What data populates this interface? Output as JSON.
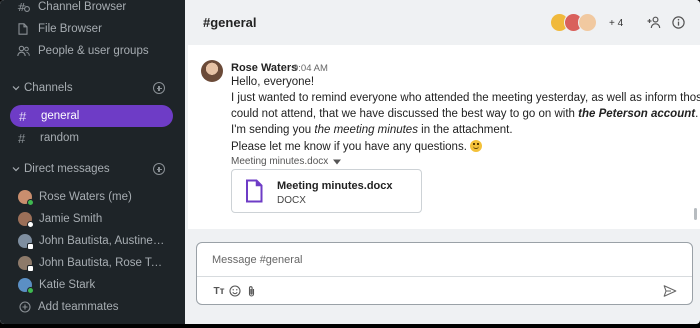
{
  "sidebar": {
    "top_items": [
      {
        "label": "Channel Browser",
        "icon": "channel-browser-icon"
      },
      {
        "label": "File Browser",
        "icon": "file-icon"
      },
      {
        "label": "People & user groups",
        "icon": "people-icon"
      }
    ],
    "channels_section": "Channels",
    "channels": [
      {
        "label": "general",
        "active": true
      },
      {
        "label": "random",
        "active": false
      }
    ],
    "dm_section": "Direct messages",
    "direct_messages": [
      {
        "label": "Rose Waters (me)",
        "status_color": "#3fb950",
        "avatar_color": "#c98e6e"
      },
      {
        "label": "Jamie Smith",
        "status_color": "#ffffff",
        "avatar_color": "#9b6f58"
      },
      {
        "label": "John Bautista, Austine W...",
        "status_color": "#ffffff",
        "avatar_color": "#7e8ea0"
      },
      {
        "label": "John Bautista, Rose Ten...",
        "status_color": "#ffffff",
        "avatar_color": "#8d7a6a"
      },
      {
        "label": "Katie Stark",
        "status_color": "#3fb950",
        "avatar_color": "#5b8fc4"
      }
    ],
    "add_teammates": "Add teammates"
  },
  "header": {
    "channel_title": "#general",
    "member_overflow": "+ 4",
    "member_avatar_colors": [
      "#f0b93c",
      "#d9605b",
      "#f1c9a0"
    ]
  },
  "message": {
    "author": "Rose Waters",
    "time": "9:04 AM",
    "line1": "Hello, everyone!",
    "line2": "I just wanted to remind everyone who attended the meeting yesterday, as well as inform those who",
    "line3_pre": "could not attend, that we have discussed the best way to go on with ",
    "line3_bold": "the Peterson account",
    "line3_post": ".",
    "line4_pre": "I'm sending you ",
    "line4_italic": "the meeting minutes",
    "line4_post": " in the attachment.",
    "line5": "Please let me know if you have any questions.",
    "emoji": "🙂"
  },
  "attachment": {
    "caption": "Meeting minutes.docx",
    "title": "Meeting minutes.docx",
    "type": "DOCX",
    "icon_color": "#6e3cc6"
  },
  "composer": {
    "placeholder": "Message #general",
    "format_label": "Tт"
  },
  "colors": {
    "accent": "#6e3cc6",
    "sidebar_bg": "#1e2428"
  }
}
